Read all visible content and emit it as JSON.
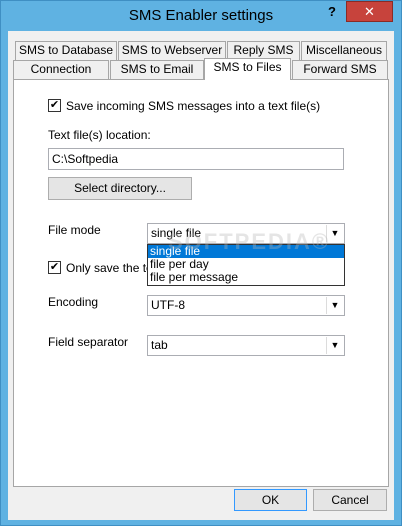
{
  "window": {
    "title": "SMS Enabler settings",
    "help_glyph": "?",
    "close_glyph": "✕"
  },
  "tabs_row1": [
    {
      "label": "SMS to Database"
    },
    {
      "label": "SMS to Webserver"
    },
    {
      "label": "Reply SMS"
    },
    {
      "label": "Miscellaneous"
    }
  ],
  "tabs_row2": [
    {
      "label": "Connection"
    },
    {
      "label": "SMS to Email"
    },
    {
      "label": "SMS to Files",
      "active": true
    },
    {
      "label": "Forward SMS"
    }
  ],
  "panel": {
    "save_checkbox": {
      "label": "Save incoming SMS messages into a text file(s)",
      "checked": true,
      "mark": "✔"
    },
    "location_label": "Text file(s) location:",
    "location_value": "C:\\Softpedia",
    "select_dir_label": "Select directory...",
    "file_mode_label": "File mode",
    "file_mode_value": "single file",
    "file_mode_options": [
      "single file",
      "file per day",
      "file per message"
    ],
    "only_save_checkbox": {
      "label": "Only save the tex",
      "checked": true,
      "mark": "✔"
    },
    "encoding_label": "Encoding",
    "encoding_value": "UTF-8",
    "field_sep_label": "Field separator",
    "field_sep_value": "tab",
    "arrow_glyph": "▼"
  },
  "watermark": "SOFTPEDIA®",
  "footer": {
    "ok_label": "OK",
    "cancel_label": "Cancel"
  }
}
